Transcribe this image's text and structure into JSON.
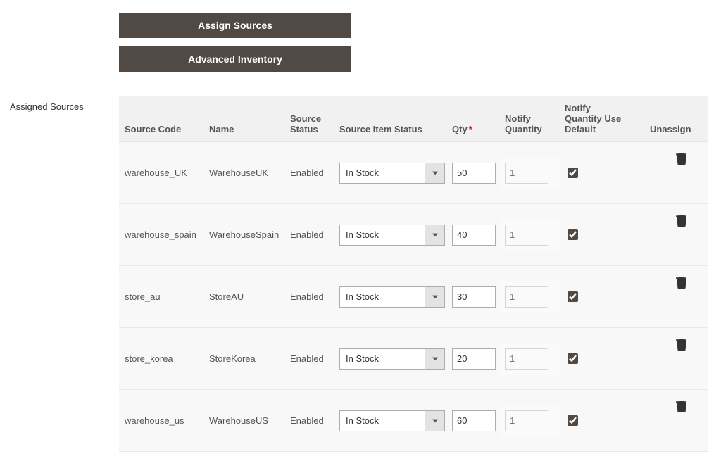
{
  "buttons": {
    "assign_sources": "Assign Sources",
    "advanced_inventory": "Advanced Inventory"
  },
  "section_title": "Assigned Sources",
  "columns": {
    "source_code": "Source Code",
    "name": "Name",
    "source_status": "Source Status",
    "source_item_status": "Source Item Status",
    "qty": "Qty",
    "notify_qty": "Notify Quantity",
    "notify_qty_use_default": "Notify Quantity Use Default",
    "unassign": "Unassign"
  },
  "required_marker": "*",
  "notify_qty_placeholder": "1",
  "rows": [
    {
      "code": "warehouse_UK",
      "name": "WarehouseUK",
      "status": "Enabled",
      "item_status": "In Stock",
      "qty": "50",
      "use_default": true
    },
    {
      "code": "warehouse_spain",
      "name": "WarehouseSpain",
      "status": "Enabled",
      "item_status": "In Stock",
      "qty": "40",
      "use_default": true
    },
    {
      "code": "store_au",
      "name": "StoreAU",
      "status": "Enabled",
      "item_status": "In Stock",
      "qty": "30",
      "use_default": true
    },
    {
      "code": "store_korea",
      "name": "StoreKorea",
      "status": "Enabled",
      "item_status": "In Stock",
      "qty": "20",
      "use_default": true
    },
    {
      "code": "warehouse_us",
      "name": "WarehouseUS",
      "status": "Enabled",
      "item_status": "In Stock",
      "qty": "60",
      "use_default": true
    }
  ]
}
